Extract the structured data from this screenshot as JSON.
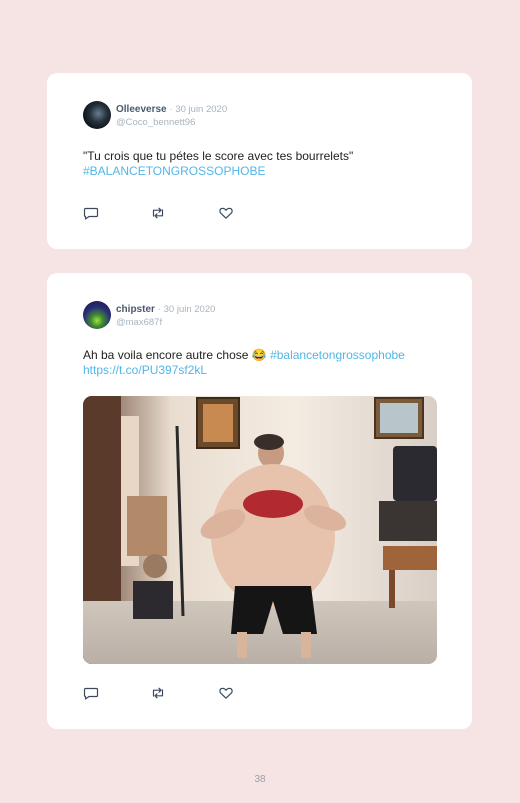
{
  "tweets": [
    {
      "display_name": "Olleeverse",
      "separator": "·",
      "date": "30 juin 2020",
      "handle": "@Coco_bennett96",
      "text": "\"Tu crois que tu pétes le score avec tes bourrelets\"",
      "hashtag": "#BALANCETONGROSSOPHOBE"
    },
    {
      "display_name": "chipster",
      "separator": "·",
      "date": "30 juin 2020",
      "handle": "@max687f",
      "text": "Ah ba voila encore autre chose 😂",
      "hashtag": "#balancetongrossophobe",
      "link": "https://t.co/PU397sf2kL"
    }
  ],
  "icons": {
    "reply": "speech-bubble-icon",
    "retweet": "retweet-icon",
    "like": "heart-icon"
  },
  "colors": {
    "page_background": "#f6e4e5",
    "hashtag": "#52b6e8",
    "name": "#4a5a6e",
    "muted": "#a8b4bf"
  },
  "page_number": "38"
}
